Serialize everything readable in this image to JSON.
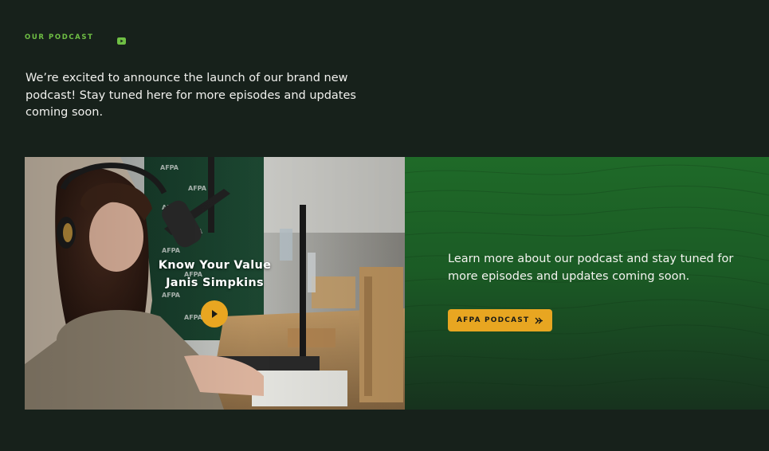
{
  "section": {
    "eyebrow": "OUR PODCAST",
    "eyebrow_icon": "youtube-icon",
    "intro": "We’re excited to announce the launch of our brand new podcast! Stay tuned here for more episodes and updates coming soon."
  },
  "episode": {
    "title": "Know Your Value",
    "guest": "Janis Simpkins",
    "play_icon": "play-icon"
  },
  "promo": {
    "text": "Learn more about our podcast and stay tuned for more episodes and updates coming soon.",
    "button_label": "AFPA PODCAST",
    "button_icon": "double-chevron-right-icon"
  },
  "colors": {
    "background": "#17211b",
    "accent_green": "#6fbf44",
    "accent_gold": "#e8a621",
    "panel_green": "#1f6a28"
  }
}
